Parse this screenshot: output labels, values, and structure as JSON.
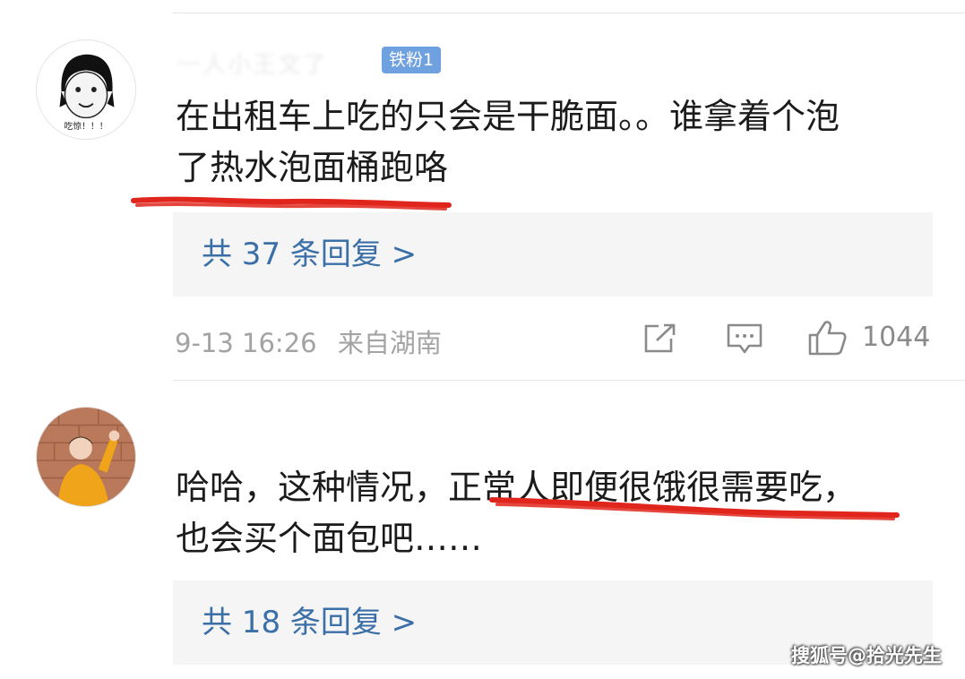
{
  "comments": [
    {
      "avatar_caption": "吃惊！！！",
      "username": "一人小王文了",
      "fan_badge": "铁粉1",
      "text_line1": "在出租车上吃的只会是干脆面。。谁拿着个泡",
      "text_line2": "了热水泡面桶跑咯",
      "reply_label": "共 37 条回复 >",
      "time": "9-13 16:26",
      "location": "来自湖南",
      "like_count": "1044"
    },
    {
      "text_line1": "哈哈，这种情况，正常人即便很饿很需要吃，",
      "text_line2": "也会买个面包吧……",
      "reply_label": "共 18 条回复 >"
    }
  ],
  "watermark": "搜狐号@拾光先生",
  "colors": {
    "link": "#3b6fa8",
    "badge": "#6fa0e0",
    "underline": "#e0261c",
    "reply_bg": "#f5f5f5",
    "meta_text": "#a3a3a3"
  },
  "icons": [
    "share-icon",
    "comment-icon",
    "thumbs-up-icon"
  ]
}
